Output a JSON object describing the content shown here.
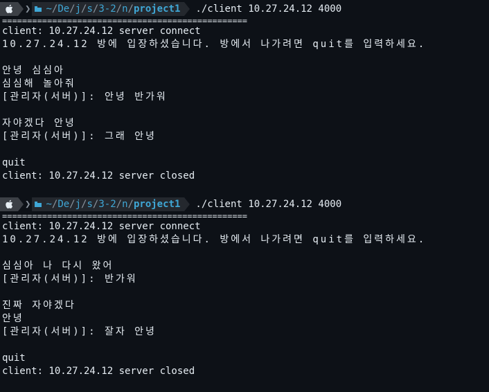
{
  "prompt": {
    "path_parts": [
      "~",
      "De",
      "j",
      "s",
      "3-2",
      "n"
    ],
    "current_dir": "project1",
    "separator": "/",
    "command": "./client 10.27.24.12 4000"
  },
  "separator_line": "=================================================",
  "sessions": [
    {
      "lines": [
        "client: 10.27.24.12 server connect",
        "10.27.24.12 방에 입장하셨습니다. 방에서 나가려면 quit를 입력하세요.",
        "",
        "안녕 심심아",
        "심심해 놀아줘",
        "[관리자(서버)]: 안녕 반가워",
        "",
        "자야겠다 안녕",
        "[관리자(서버)]: 그래 안녕",
        "",
        "quit",
        "client: 10.27.24.12 server closed"
      ]
    },
    {
      "lines": [
        "client: 10.27.24.12 server connect",
        "10.27.24.12 방에 입장하셨습니다. 방에서 나가려면 quit를 입력하세요.",
        "",
        "심심아 나 다시 왔어",
        "[관리자(서버)]: 반가워",
        "",
        "진짜 자야겠다",
        "안녕",
        "[관리자(서버)]: 잘자 안녕",
        "",
        "quit",
        "client: 10.27.24.12 server closed"
      ]
    }
  ],
  "colors": {
    "background": "#0d1117",
    "text": "#e6edf3",
    "path": "#3fa7d6",
    "prompt_segment_1": "#3c4046",
    "prompt_segment_2": "#24282e"
  },
  "icons": [
    "apple-icon",
    "folder-icon",
    "chevron-right-icon"
  ]
}
